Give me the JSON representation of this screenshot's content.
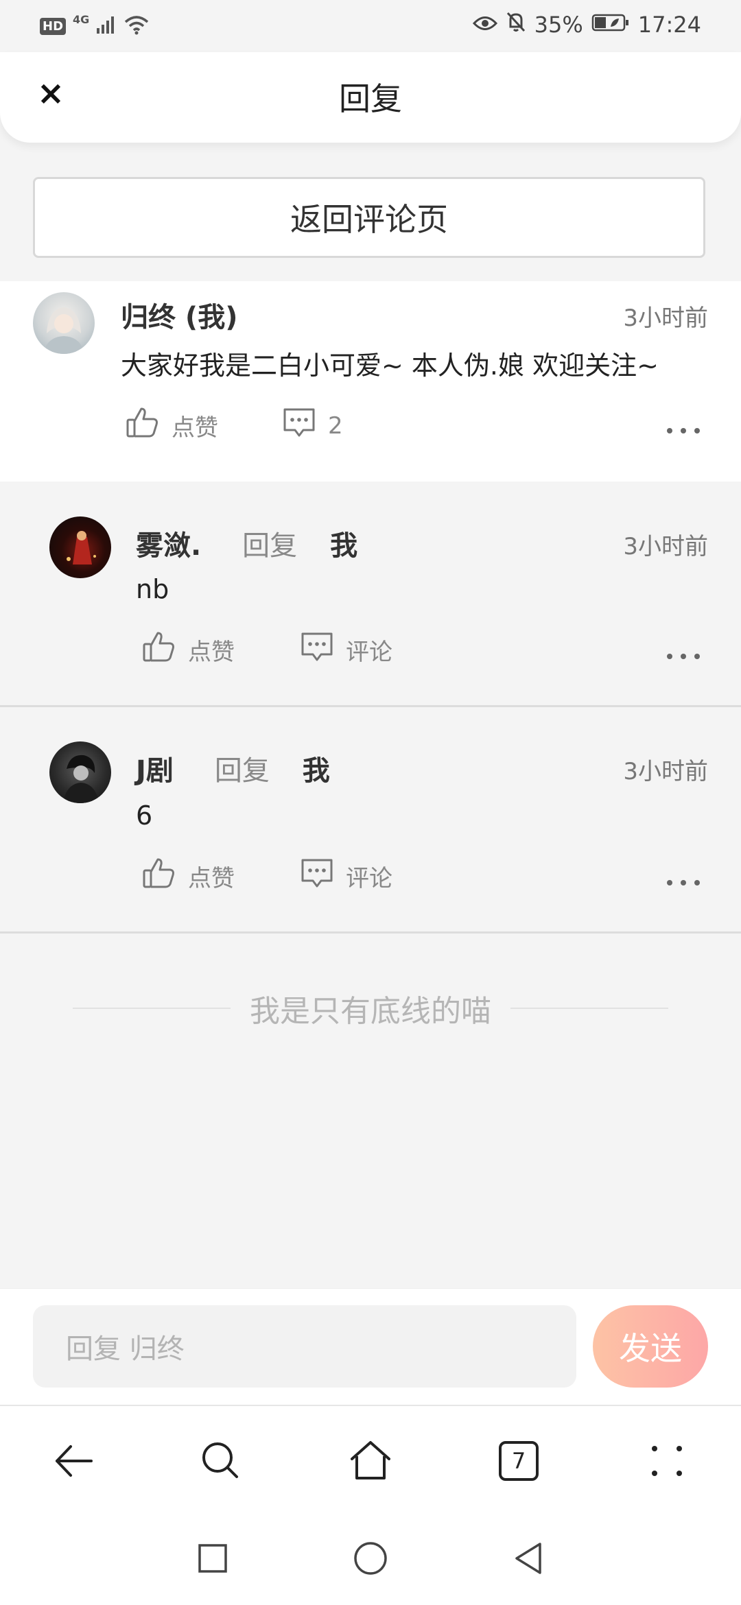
{
  "status_bar": {
    "network_badge": "HD",
    "network_type": "4G",
    "battery": "35%",
    "time": "17:24",
    "icons": [
      "hd-icon",
      "signal-icon",
      "wifi-icon",
      "eye-icon",
      "mute-bell-icon",
      "battery-icon"
    ]
  },
  "header": {
    "close_icon": "×",
    "title": "回复"
  },
  "back_button": "返回评论页",
  "main_comment": {
    "username": "归终 (我)",
    "time": "3小时前",
    "text": "大家好我是二白小可爱~ 本人伪.娘 欢迎关注~",
    "like_label": "点赞",
    "comment_count": "2"
  },
  "replies": [
    {
      "username": "雾潋.",
      "reply_word": "回复",
      "target": "我",
      "time": "3小时前",
      "text": "nb",
      "like_label": "点赞",
      "comment_label": "评论"
    },
    {
      "username": "J剧",
      "reply_word": "回复",
      "target": "我",
      "time": "3小时前",
      "text": "6",
      "like_label": "点赞",
      "comment_label": "评论"
    }
  ],
  "bottom_line_text": "我是只有底线的喵",
  "input_bar": {
    "placeholder": "回复 归终",
    "send_label": "发送"
  },
  "browser_nav": {
    "tabs_count": "7"
  },
  "colors": {
    "send_gradient_start": "#fdc3a5",
    "send_gradient_end": "#fda7a7",
    "page_bg": "#f4f4f4"
  }
}
